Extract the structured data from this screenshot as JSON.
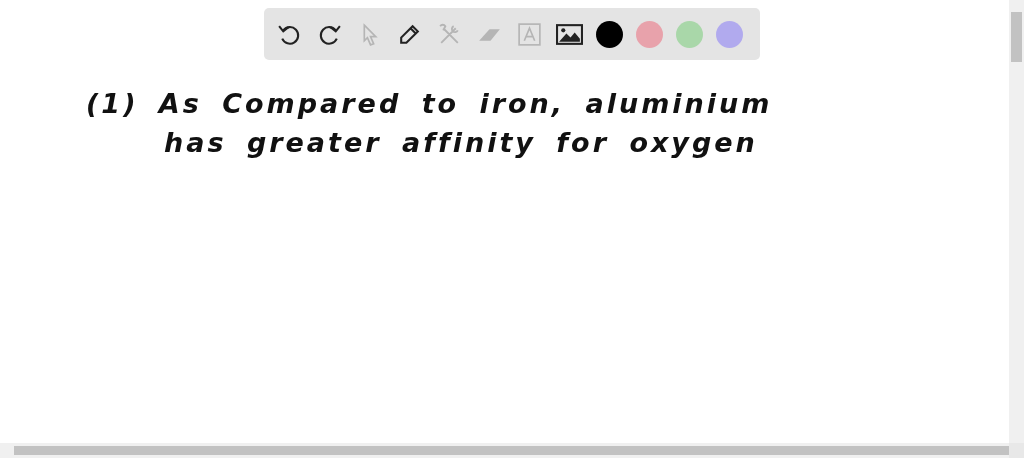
{
  "toolbar": {
    "tools": [
      {
        "kind": "undo",
        "disabled": false
      },
      {
        "kind": "redo",
        "disabled": false
      },
      {
        "kind": "select",
        "disabled": true
      },
      {
        "kind": "pencil",
        "disabled": false
      },
      {
        "kind": "tools",
        "disabled": true
      },
      {
        "kind": "eraser",
        "disabled": true
      },
      {
        "kind": "text",
        "disabled": true
      },
      {
        "kind": "image",
        "disabled": false
      }
    ],
    "colors": [
      {
        "color": "#000000"
      },
      {
        "color": "#e8a2ab"
      },
      {
        "color": "#a9d7a9"
      },
      {
        "color": "#b1aaee"
      }
    ]
  },
  "canvas": {
    "lines": [
      "(1)  As Compared to iron, aluminium",
      "has greater affinity for oxygen"
    ]
  }
}
